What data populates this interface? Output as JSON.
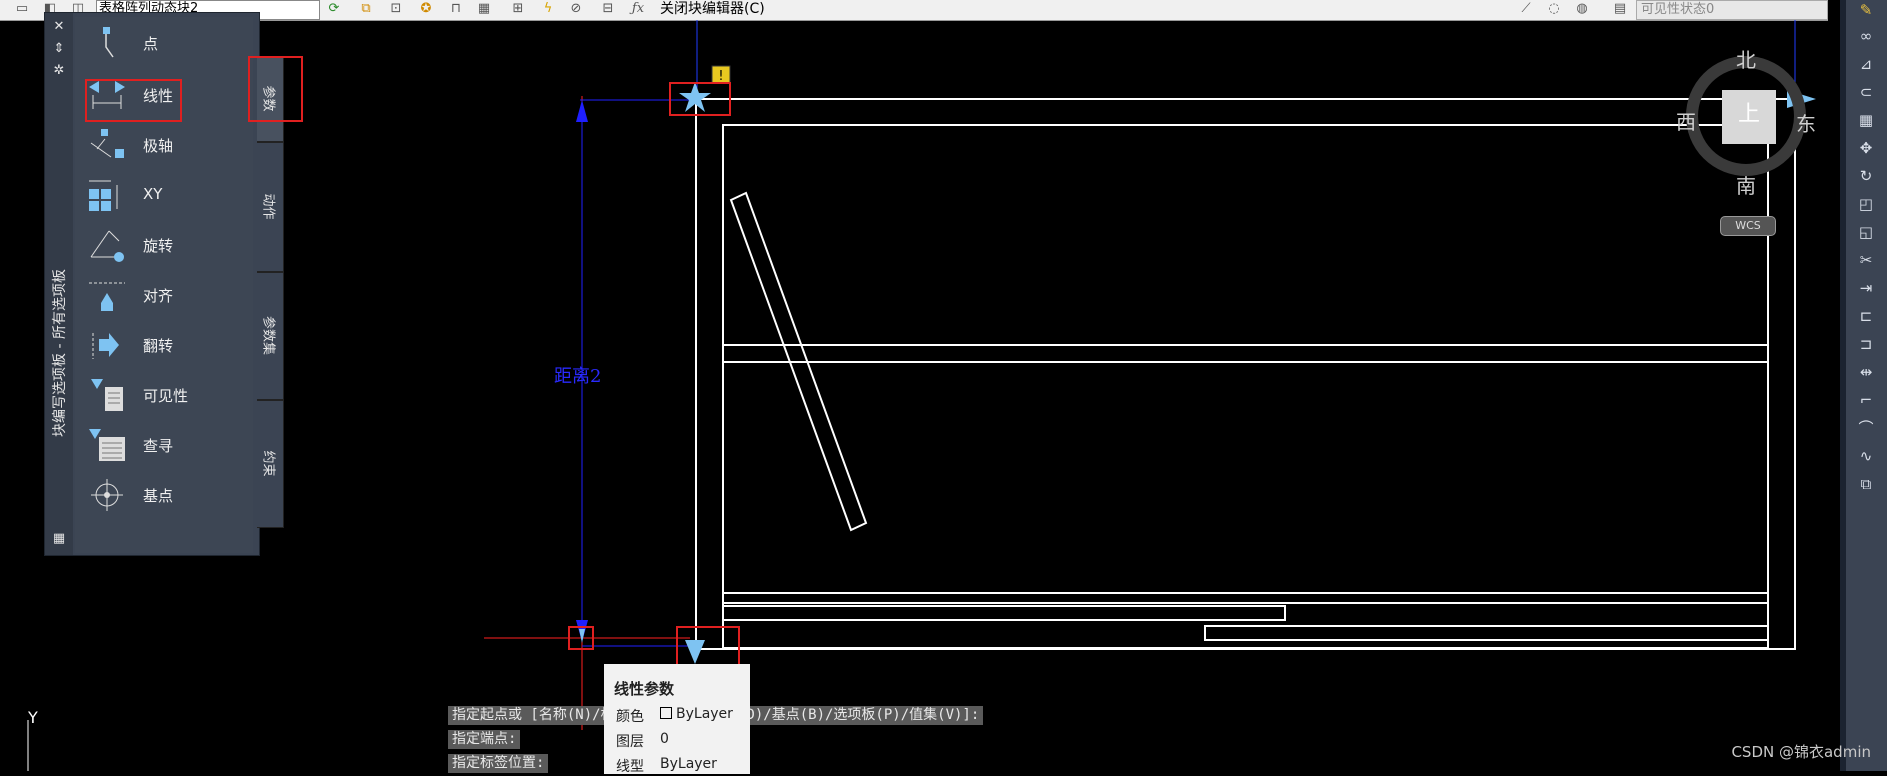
{
  "toolbar": {
    "block_name": "表格阵列动态块2",
    "close_editor_label": "关闭块编辑器(C)",
    "visibility_state_label": "可见性状态0",
    "icons": [
      "block-icon",
      "save-icon",
      "attribute-icon",
      "authoring-icon",
      "lock-icon",
      "table-icon",
      "test-icon",
      "lightning-icon",
      "param-manager-icon",
      "fx-icon"
    ]
  },
  "palette": {
    "title": "块编写选项板 - 所有选项板",
    "items": [
      {
        "label": "点",
        "icon": "point-param-icon"
      },
      {
        "label": "线性",
        "icon": "linear-param-icon"
      },
      {
        "label": "极轴",
        "icon": "polar-param-icon"
      },
      {
        "label": "XY",
        "icon": "xy-param-icon"
      },
      {
        "label": "旋转",
        "icon": "rotation-param-icon"
      },
      {
        "label": "对齐",
        "icon": "alignment-param-icon"
      },
      {
        "label": "翻转",
        "icon": "flip-param-icon"
      },
      {
        "label": "可见性",
        "icon": "visibility-param-icon"
      },
      {
        "label": "查寻",
        "icon": "lookup-param-icon"
      },
      {
        "label": "基点",
        "icon": "basepoint-param-icon"
      }
    ],
    "tabs": [
      "参数",
      "动作",
      "参数集",
      "约束"
    ]
  },
  "drawing": {
    "dimension_label": "距离2",
    "ucs_y_label": "Y"
  },
  "viewcube": {
    "north": "北",
    "south": "南",
    "east": "东",
    "west": "西",
    "face": "上",
    "wcs": "WCS"
  },
  "command": {
    "line1": "指定起点或 [名称(N)/标签(L)/链(C)/说明(D)/基点(B)/选项板(P)/值集(V)]:",
    "line2": "指定端点:",
    "line3": "指定标签位置:"
  },
  "tooltip": {
    "title": "线性参数",
    "rows": [
      {
        "key": "颜色",
        "value": "ByLayer"
      },
      {
        "key": "图层",
        "value": "0"
      },
      {
        "key": "线型",
        "value": "ByLayer"
      }
    ]
  },
  "watermark": "CSDN @锦衣admin",
  "colors": {
    "canvas": "#000000",
    "palette_bg": "#3b4453",
    "highlight": "#e02020",
    "dimension": "#1f1fff",
    "param_icon": "#7ec3f2"
  }
}
